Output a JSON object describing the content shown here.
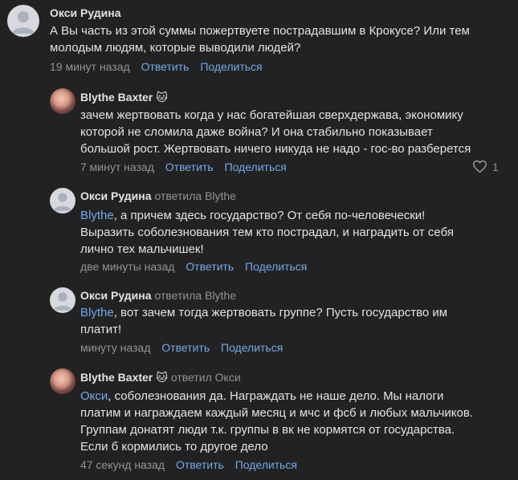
{
  "comments": [
    {
      "author": "Окси Рудина",
      "replied_to": "",
      "mention": "",
      "lines": [
        "А Вы часть из этой суммы пожертвуете пострадавшим в Крокусе? Или тем",
        "молодым людям, которые выводили людей?"
      ],
      "time": "19 минут назад",
      "reply": "Ответить",
      "share": "Поделиться"
    },
    {
      "author": "Blythe Baxter",
      "author_emoji": "🐱",
      "replied_to": "",
      "lines": [
        "зачем жертвовать когда у нас богатейшая сверхдержава, экономику",
        "которой не сломила даже война? И она стабильно показывает",
        "большой рост. Жертвовать ничего никуда не надо - гос-во разберется"
      ],
      "time": "7 минут назад",
      "reply": "Ответить",
      "share": "Поделиться",
      "likes": "1"
    },
    {
      "author": "Окси Рудина",
      "replied_to": "ответила Blythe",
      "mention": "Blythe",
      "lines": [
        ", а причем здесь государство? От себя по-человечески!",
        "Выразить соболезнования тем кто пострадал, и наградить от себя",
        "лично тех мальчишек!"
      ],
      "time": "две минуты назад",
      "reply": "Ответить",
      "share": "Поделиться"
    },
    {
      "author": "Окси Рудина",
      "replied_to": "ответила Blythe",
      "mention": "Blythe",
      "lines": [
        ", вот зачем тогда жертвовать группе? Пусть государство им",
        "платит!"
      ],
      "time": "минуту назад",
      "reply": "Ответить",
      "share": "Поделиться"
    },
    {
      "author": "Blythe Baxter",
      "author_emoji": "🐱",
      "replied_to": "ответил Окси",
      "mention": "Окси",
      "lines": [
        ", соболезнования да. Награждать не наше дело. Мы налоги",
        "платим и награждаем каждый месяц и мчс и фсб и любых мальчиков.",
        "Группам донатят люди т.к. группы в вк не кормятся от государства.",
        "Если б кормились то другое дело"
      ],
      "time": "47 секунд назад",
      "reply": "Ответить",
      "share": "Поделиться"
    }
  ],
  "colors": {
    "background": "#222222",
    "text": "#e1e3e6",
    "secondary": "#939393",
    "link": "#71aaeb"
  },
  "icons": {
    "default_avatar": "user-silhouette-icon",
    "like": "heart-icon"
  }
}
